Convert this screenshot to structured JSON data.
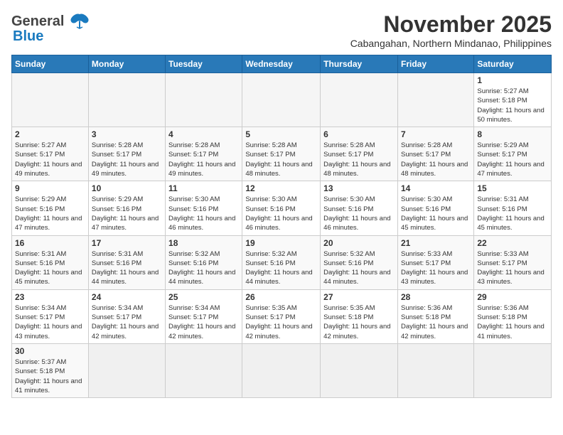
{
  "header": {
    "logo_general": "General",
    "logo_blue": "Blue",
    "month_title": "November 2025",
    "location": "Cabangahan, Northern Mindanao, Philippines"
  },
  "days_of_week": [
    "Sunday",
    "Monday",
    "Tuesday",
    "Wednesday",
    "Thursday",
    "Friday",
    "Saturday"
  ],
  "weeks": [
    {
      "days": [
        {
          "num": "",
          "empty": true
        },
        {
          "num": "",
          "empty": true
        },
        {
          "num": "",
          "empty": true
        },
        {
          "num": "",
          "empty": true
        },
        {
          "num": "",
          "empty": true
        },
        {
          "num": "",
          "empty": true
        },
        {
          "num": "1",
          "sunrise": "5:27 AM",
          "sunset": "5:18 PM",
          "daylight": "11 hours and 50 minutes."
        }
      ]
    },
    {
      "days": [
        {
          "num": "2",
          "sunrise": "5:27 AM",
          "sunset": "5:17 PM",
          "daylight": "11 hours and 49 minutes."
        },
        {
          "num": "3",
          "sunrise": "5:28 AM",
          "sunset": "5:17 PM",
          "daylight": "11 hours and 49 minutes."
        },
        {
          "num": "4",
          "sunrise": "5:28 AM",
          "sunset": "5:17 PM",
          "daylight": "11 hours and 49 minutes."
        },
        {
          "num": "5",
          "sunrise": "5:28 AM",
          "sunset": "5:17 PM",
          "daylight": "11 hours and 48 minutes."
        },
        {
          "num": "6",
          "sunrise": "5:28 AM",
          "sunset": "5:17 PM",
          "daylight": "11 hours and 48 minutes."
        },
        {
          "num": "7",
          "sunrise": "5:28 AM",
          "sunset": "5:17 PM",
          "daylight": "11 hours and 48 minutes."
        },
        {
          "num": "8",
          "sunrise": "5:29 AM",
          "sunset": "5:17 PM",
          "daylight": "11 hours and 47 minutes."
        }
      ]
    },
    {
      "days": [
        {
          "num": "9",
          "sunrise": "5:29 AM",
          "sunset": "5:16 PM",
          "daylight": "11 hours and 47 minutes."
        },
        {
          "num": "10",
          "sunrise": "5:29 AM",
          "sunset": "5:16 PM",
          "daylight": "11 hours and 47 minutes."
        },
        {
          "num": "11",
          "sunrise": "5:30 AM",
          "sunset": "5:16 PM",
          "daylight": "11 hours and 46 minutes."
        },
        {
          "num": "12",
          "sunrise": "5:30 AM",
          "sunset": "5:16 PM",
          "daylight": "11 hours and 46 minutes."
        },
        {
          "num": "13",
          "sunrise": "5:30 AM",
          "sunset": "5:16 PM",
          "daylight": "11 hours and 46 minutes."
        },
        {
          "num": "14",
          "sunrise": "5:30 AM",
          "sunset": "5:16 PM",
          "daylight": "11 hours and 45 minutes."
        },
        {
          "num": "15",
          "sunrise": "5:31 AM",
          "sunset": "5:16 PM",
          "daylight": "11 hours and 45 minutes."
        }
      ]
    },
    {
      "days": [
        {
          "num": "16",
          "sunrise": "5:31 AM",
          "sunset": "5:16 PM",
          "daylight": "11 hours and 45 minutes."
        },
        {
          "num": "17",
          "sunrise": "5:31 AM",
          "sunset": "5:16 PM",
          "daylight": "11 hours and 44 minutes."
        },
        {
          "num": "18",
          "sunrise": "5:32 AM",
          "sunset": "5:16 PM",
          "daylight": "11 hours and 44 minutes."
        },
        {
          "num": "19",
          "sunrise": "5:32 AM",
          "sunset": "5:16 PM",
          "daylight": "11 hours and 44 minutes."
        },
        {
          "num": "20",
          "sunrise": "5:32 AM",
          "sunset": "5:16 PM",
          "daylight": "11 hours and 44 minutes."
        },
        {
          "num": "21",
          "sunrise": "5:33 AM",
          "sunset": "5:17 PM",
          "daylight": "11 hours and 43 minutes."
        },
        {
          "num": "22",
          "sunrise": "5:33 AM",
          "sunset": "5:17 PM",
          "daylight": "11 hours and 43 minutes."
        }
      ]
    },
    {
      "days": [
        {
          "num": "23",
          "sunrise": "5:34 AM",
          "sunset": "5:17 PM",
          "daylight": "11 hours and 43 minutes."
        },
        {
          "num": "24",
          "sunrise": "5:34 AM",
          "sunset": "5:17 PM",
          "daylight": "11 hours and 42 minutes."
        },
        {
          "num": "25",
          "sunrise": "5:34 AM",
          "sunset": "5:17 PM",
          "daylight": "11 hours and 42 minutes."
        },
        {
          "num": "26",
          "sunrise": "5:35 AM",
          "sunset": "5:17 PM",
          "daylight": "11 hours and 42 minutes."
        },
        {
          "num": "27",
          "sunrise": "5:35 AM",
          "sunset": "5:18 PM",
          "daylight": "11 hours and 42 minutes."
        },
        {
          "num": "28",
          "sunrise": "5:36 AM",
          "sunset": "5:18 PM",
          "daylight": "11 hours and 42 minutes."
        },
        {
          "num": "29",
          "sunrise": "5:36 AM",
          "sunset": "5:18 PM",
          "daylight": "11 hours and 41 minutes."
        }
      ]
    },
    {
      "days": [
        {
          "num": "30",
          "sunrise": "5:37 AM",
          "sunset": "5:18 PM",
          "daylight": "11 hours and 41 minutes."
        },
        {
          "num": "",
          "empty": true
        },
        {
          "num": "",
          "empty": true
        },
        {
          "num": "",
          "empty": true
        },
        {
          "num": "",
          "empty": true
        },
        {
          "num": "",
          "empty": true
        },
        {
          "num": "",
          "empty": true
        }
      ]
    }
  ],
  "labels": {
    "sunrise": "Sunrise:",
    "sunset": "Sunset:",
    "daylight": "Daylight:"
  }
}
